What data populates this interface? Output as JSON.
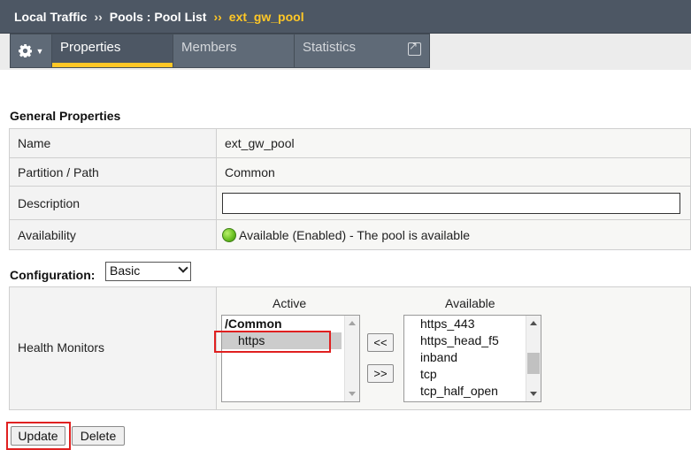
{
  "breadcrumb": {
    "items": [
      "Local Traffic",
      "Pools : Pool List"
    ],
    "separator": "››",
    "current": "ext_gw_pool"
  },
  "tabs": {
    "properties": "Properties",
    "members": "Members",
    "statistics": "Statistics"
  },
  "general": {
    "title": "General Properties",
    "rows": [
      {
        "label": "Name",
        "value": "ext_gw_pool"
      },
      {
        "label": "Partition / Path",
        "value": "Common"
      },
      {
        "label": "Description",
        "value": ""
      },
      {
        "label": "Availability",
        "value": "Available (Enabled) - The pool is available"
      }
    ]
  },
  "configuration": {
    "label": "Configuration:",
    "selected": "Basic"
  },
  "health_monitors": {
    "label": "Health Monitors",
    "active_heading": "Active",
    "available_heading": "Available",
    "active_group": "/Common",
    "active_items": [
      "https"
    ],
    "available_items": [
      "https_443",
      "https_head_f5",
      "inband",
      "tcp",
      "tcp_half_open"
    ],
    "add_label": "<<",
    "remove_label": ">>"
  },
  "actions": {
    "update": "Update",
    "delete": "Delete"
  },
  "colors": {
    "accent": "#ffc726",
    "header_bg": "#4d5764",
    "highlight_red": "#e02020",
    "status_green": "#6cc224"
  }
}
